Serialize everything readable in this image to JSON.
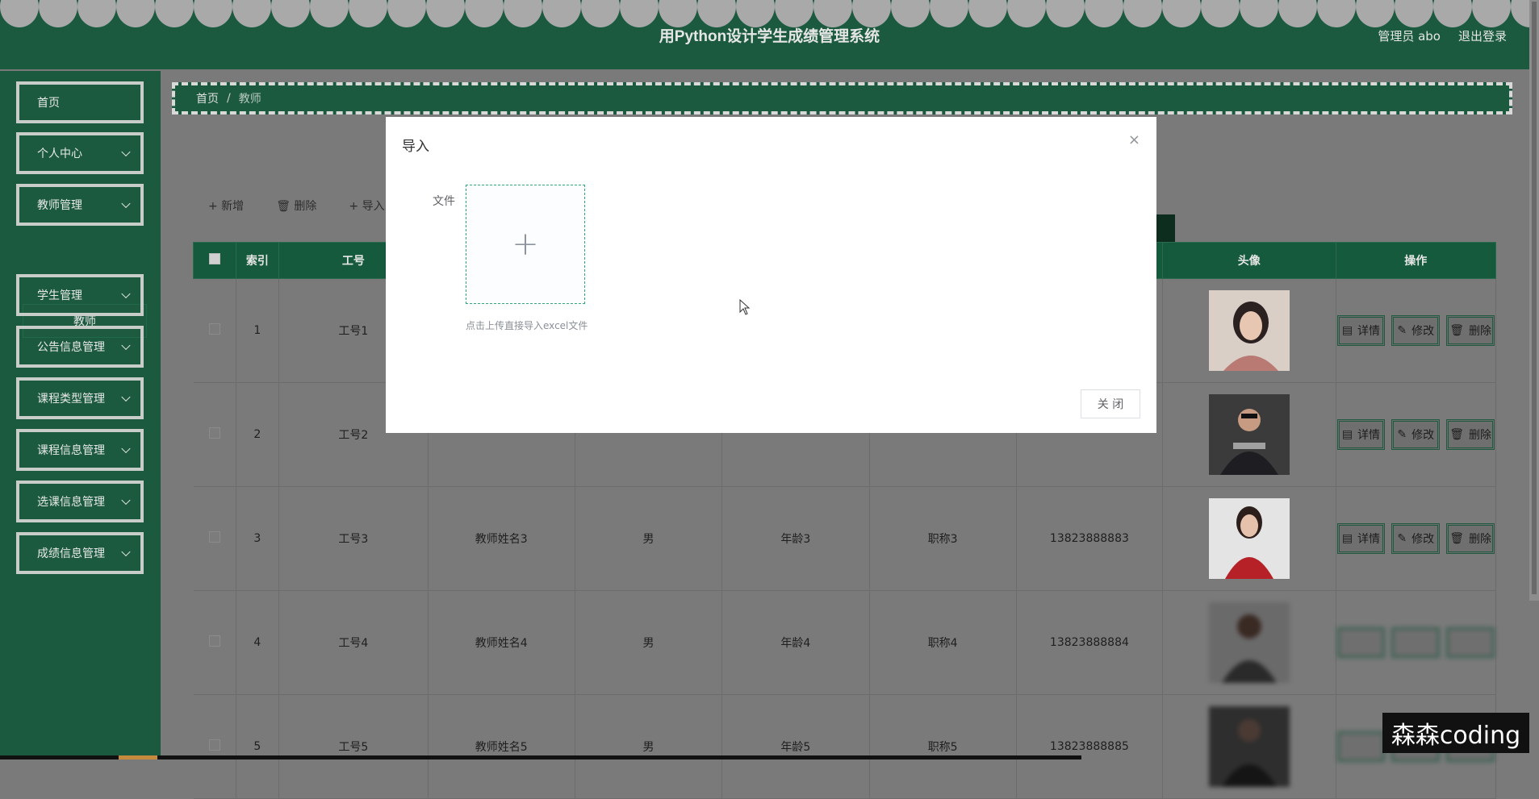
{
  "header": {
    "title": "用Python设计学生成绩管理系统",
    "user_label": "管理员 abo",
    "logout_label": "退出登录"
  },
  "sidebar": {
    "items": [
      {
        "label": "首页"
      },
      {
        "label": "个人中心"
      },
      {
        "label": "教师管理"
      },
      {
        "label": "学生管理"
      },
      {
        "label": "公告信息管理"
      },
      {
        "label": "课程类型管理"
      },
      {
        "label": "课程信息管理"
      },
      {
        "label": "选课信息管理"
      },
      {
        "label": "成绩信息管理"
      }
    ],
    "submenu": {
      "label": "教师"
    }
  },
  "breadcrumb": {
    "home": "首页",
    "sep": "/",
    "current": "教师"
  },
  "toolbar": {
    "add": "+ 新增",
    "delete": "🗑 删除",
    "import": "+ 导入"
  },
  "table": {
    "headers": {
      "index": "索引",
      "job_no": "工号",
      "avatar": "头像",
      "ops": "操作"
    },
    "rows": [
      {
        "index": "1",
        "job_no": "工号1",
        "name": "",
        "gender": "",
        "age": "",
        "title": "",
        "phone": ""
      },
      {
        "index": "2",
        "job_no": "工号2",
        "name": "",
        "gender": "",
        "age": "",
        "title": "",
        "phone": ""
      },
      {
        "index": "3",
        "job_no": "工号3",
        "name": "教师姓名3",
        "gender": "男",
        "age": "年龄3",
        "title": "职称3",
        "phone": "13823888883"
      },
      {
        "index": "4",
        "job_no": "工号4",
        "name": "教师姓名4",
        "gender": "男",
        "age": "年龄4",
        "title": "职称4",
        "phone": "13823888884"
      },
      {
        "index": "5",
        "job_no": "工号5",
        "name": "教师姓名5",
        "gender": "男",
        "age": "年龄5",
        "title": "职称5",
        "phone": "13823888885"
      }
    ],
    "actions": {
      "detail": "详情",
      "edit": "修改",
      "delete": "删除"
    }
  },
  "dialog": {
    "title": "导入",
    "close_icon": "×",
    "file_label": "文件",
    "upload_plus": "+",
    "upload_tip": "点击上传直接导入excel文件",
    "close_button": "关 闭"
  },
  "watermark": "森森coding",
  "colors": {
    "theme_green": "#1b5a3f",
    "overlay_gray": "#7a7a7a",
    "upload_border": "#2fa87a"
  }
}
